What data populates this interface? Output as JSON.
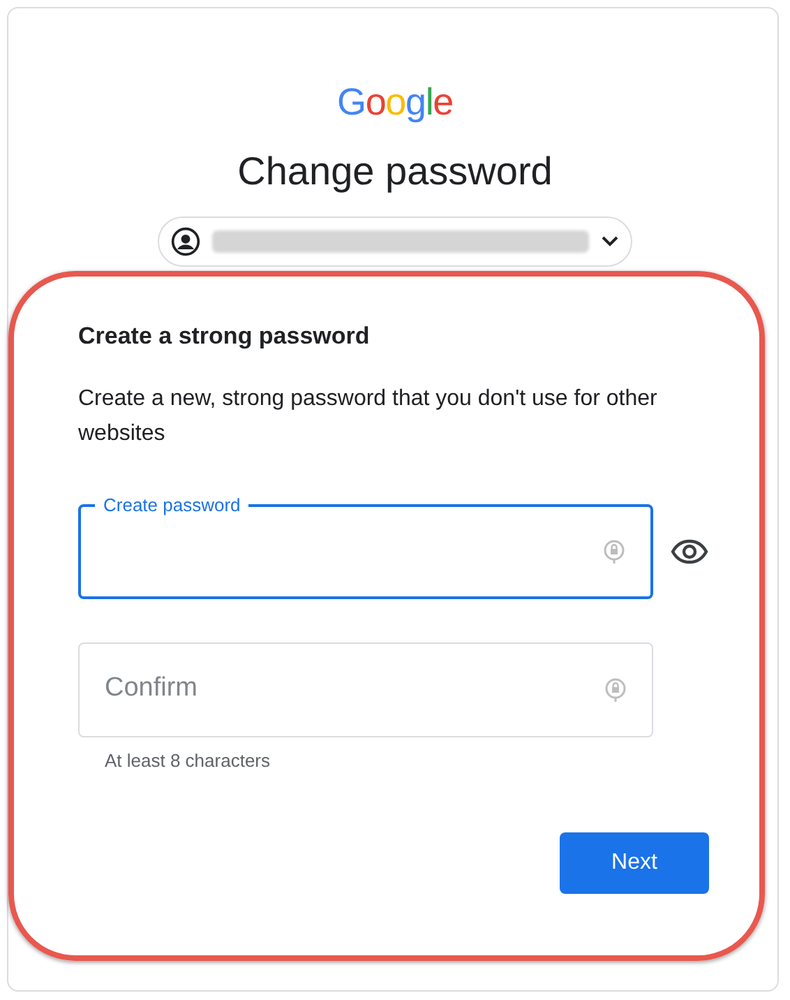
{
  "logo": "Google",
  "title": "Change password",
  "account": {
    "email_blurred": true
  },
  "section": {
    "heading": "Create a strong password",
    "description": "Create a new, strong password that you don't use for other websites"
  },
  "fields": [
    {
      "label": "Create password",
      "focused": true,
      "show_toggle": true
    },
    {
      "label": "Confirm",
      "focused": false,
      "show_toggle": false
    }
  ],
  "helper": "At least 8 characters",
  "buttons": [
    {
      "label": "Next"
    }
  ]
}
